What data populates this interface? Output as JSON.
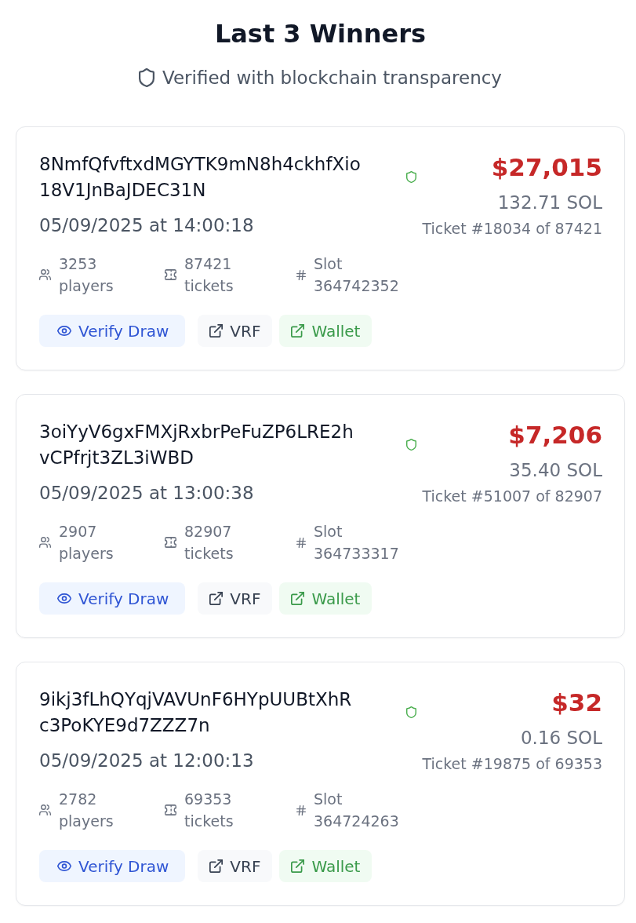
{
  "header": {
    "title": "Last 3 Winners",
    "subtitle": "Verified with blockchain transparency"
  },
  "winners": [
    {
      "address": "8NmfQfvftxdMGYTK9mN8h4ckhfXio18V1JnBaJDEC31N",
      "verified": true,
      "date": "05/09/2025 at 14:00:18",
      "amount": "$27,015",
      "sol": "132.71 SOL",
      "ticket": "Ticket #18034 of 87421",
      "stats": [
        {
          "kind": "players",
          "text": "3253 players"
        },
        {
          "kind": "tickets",
          "text": "87421 tickets"
        },
        {
          "kind": "slot",
          "text": "Slot 364742352"
        }
      ],
      "buttons": [
        {
          "kind": "verify",
          "label": "Verify Draw"
        },
        {
          "kind": "vrf",
          "label": "VRF"
        },
        {
          "kind": "wallet",
          "label": "Wallet"
        }
      ]
    },
    {
      "address": "3oiYyV6gxFMXjRxbrPeFuZP6LRE2hvCPfrjt3ZL3iWBD",
      "verified": true,
      "date": "05/09/2025 at 13:00:38",
      "amount": "$7,206",
      "sol": "35.40 SOL",
      "ticket": "Ticket #51007 of 82907",
      "stats": [
        {
          "kind": "players",
          "text": "2907 players"
        },
        {
          "kind": "tickets",
          "text": "82907 tickets"
        },
        {
          "kind": "slot",
          "text": "Slot 364733317"
        }
      ],
      "buttons": [
        {
          "kind": "verify",
          "label": "Verify Draw"
        },
        {
          "kind": "vrf",
          "label": "VRF"
        },
        {
          "kind": "wallet",
          "label": "Wallet"
        }
      ]
    },
    {
      "address": "9ikj3fLhQYqjVAVUnF6HYpUUBtXhRc3PoKYE9d7ZZZ7n",
      "verified": true,
      "date": "05/09/2025 at 12:00:13",
      "amount": "$32",
      "sol": "0.16 SOL",
      "ticket": "Ticket #19875 of 69353",
      "stats": [
        {
          "kind": "players",
          "text": "2782 players"
        },
        {
          "kind": "tickets",
          "text": "69353 tickets"
        },
        {
          "kind": "slot",
          "text": "Slot 364724263"
        }
      ],
      "buttons": [
        {
          "kind": "verify",
          "label": "Verify Draw"
        },
        {
          "kind": "vrf",
          "label": "VRF"
        },
        {
          "kind": "wallet",
          "label": "Wallet"
        }
      ]
    }
  ]
}
